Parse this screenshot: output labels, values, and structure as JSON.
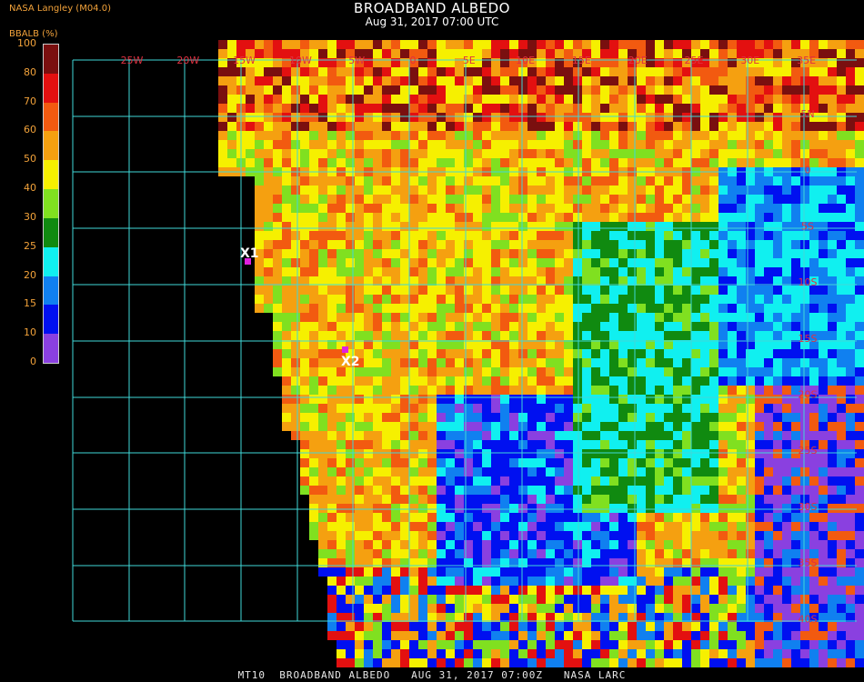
{
  "header": {
    "title": "BROADBAND ALBEDO",
    "datetime": "Aug 31, 2017 07:00 UTC",
    "provider": "NASA Langley (M04.0)"
  },
  "colorbar": {
    "label": "BBALB (%)",
    "ticks": [
      "100",
      "80",
      "70",
      "60",
      "50",
      "40",
      "30",
      "25",
      "20",
      "15",
      "10",
      "0"
    ],
    "bands": [
      {
        "from": 80,
        "to": 100,
        "color": "#7a0f0f"
      },
      {
        "from": 70,
        "to": 80,
        "color": "#e31010"
      },
      {
        "from": 60,
        "to": 70,
        "color": "#f25a10"
      },
      {
        "from": 50,
        "to": 60,
        "color": "#f5a010"
      },
      {
        "from": 40,
        "to": 50,
        "color": "#f6f000"
      },
      {
        "from": 30,
        "to": 40,
        "color": "#80e020"
      },
      {
        "from": 25,
        "to": 30,
        "color": "#108a10"
      },
      {
        "from": 20,
        "to": 25,
        "color": "#10f0f0"
      },
      {
        "from": 15,
        "to": 20,
        "color": "#1080f0"
      },
      {
        "from": 10,
        "to": 15,
        "color": "#0010f0"
      },
      {
        "from": 0,
        "to": 10,
        "color": "#8a40e0"
      }
    ]
  },
  "grid": {
    "lon_labels": [
      "25W",
      "20W",
      "15W",
      "10W",
      "5W",
      "0",
      "5E",
      "10E",
      "15E",
      "20E",
      "25E",
      "30E",
      "35E"
    ],
    "lat_labels": [
      "5N",
      "0",
      "5S",
      "10S",
      "15S",
      "20S",
      "25S",
      "30S",
      "35S",
      "40S"
    ],
    "line_color": "#40d8d8"
  },
  "markers": [
    {
      "label": "X1",
      "color": "#e020e0"
    },
    {
      "label": "X2",
      "color": "#e020e0"
    }
  ],
  "footer": "MT10  BROADBAND ALBEDO   AUG 31, 2017 07:00Z   NASA LARC"
}
